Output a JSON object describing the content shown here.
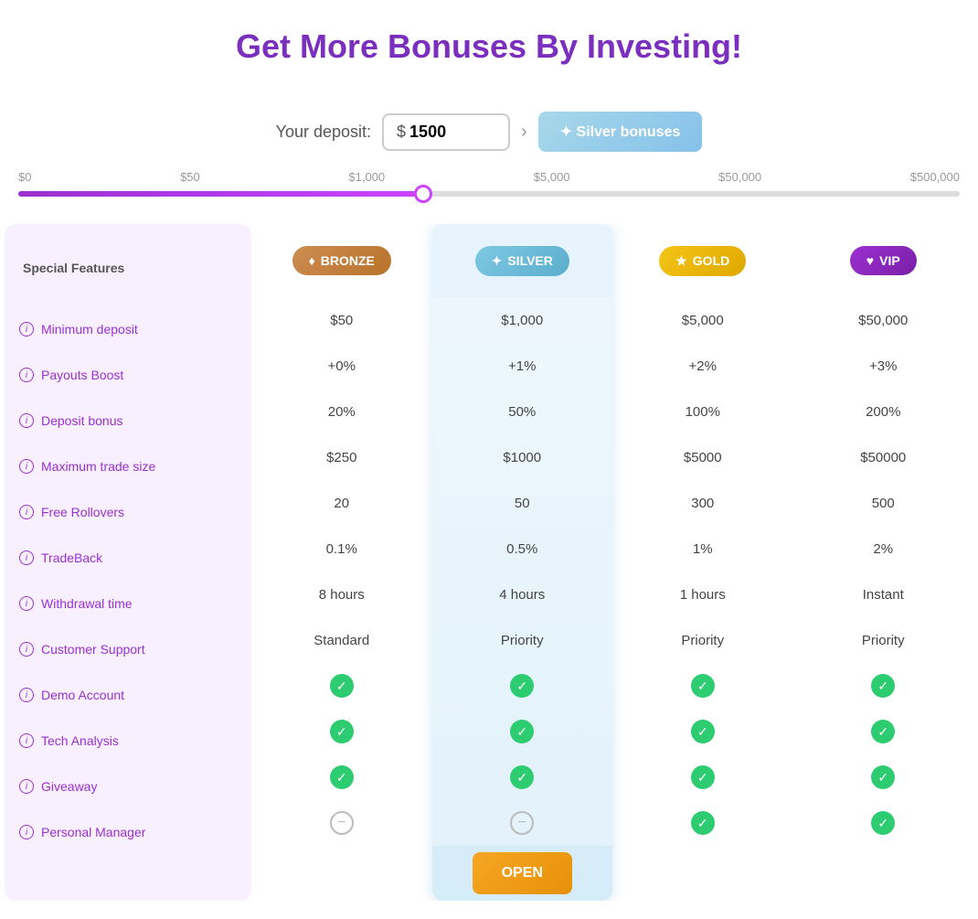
{
  "header": {
    "title": "Get More Bonuses By Investing!"
  },
  "deposit": {
    "label": "Your deposit:",
    "value": "1500",
    "dollar_sign": "$",
    "arrow": "›",
    "button_label": "✦ Silver bonuses"
  },
  "slider": {
    "labels": [
      "$0",
      "$50",
      "$1,000",
      "$5,000",
      "$50,000",
      "$500,000"
    ],
    "fill_percent": 43
  },
  "features": {
    "header": "Special Features",
    "rows": [
      {
        "label": "Minimum deposit"
      },
      {
        "label": "Payouts Boost"
      },
      {
        "label": "Deposit bonus"
      },
      {
        "label": "Maximum trade size"
      },
      {
        "label": "Free Rollovers"
      },
      {
        "label": "TradeBack"
      },
      {
        "label": "Withdrawal time"
      },
      {
        "label": "Customer Support"
      },
      {
        "label": "Demo Account"
      },
      {
        "label": "Tech Analysis"
      },
      {
        "label": "Giveaway"
      },
      {
        "label": "Personal Manager"
      }
    ]
  },
  "tiers": [
    {
      "id": "bronze",
      "badge_label": "BRONZE",
      "badge_symbol": "♦",
      "badge_class": "badge-bronze",
      "values": [
        "$50",
        "+0%",
        "20%",
        "$250",
        "20",
        "0.1%",
        "8 hours",
        "Standard"
      ],
      "demo_account": true,
      "tech_analysis": true,
      "giveaway": true,
      "personal_manager": false,
      "has_button": false
    },
    {
      "id": "silver",
      "badge_label": "SILVER",
      "badge_symbol": "✦",
      "badge_class": "badge-silver",
      "values": [
        "$1,000",
        "+1%",
        "50%",
        "$1000",
        "50",
        "0.5%",
        "4 hours",
        "Priority"
      ],
      "demo_account": true,
      "tech_analysis": true,
      "giveaway": true,
      "personal_manager": false,
      "has_button": true,
      "button_label": "OPEN"
    },
    {
      "id": "gold",
      "badge_label": "GOLD",
      "badge_symbol": "★",
      "badge_class": "badge-gold",
      "values": [
        "$5,000",
        "+2%",
        "100%",
        "$5000",
        "300",
        "1%",
        "1 hours",
        "Priority"
      ],
      "demo_account": true,
      "tech_analysis": true,
      "giveaway": true,
      "personal_manager": true,
      "has_button": false
    },
    {
      "id": "vip",
      "badge_label": "VIP",
      "badge_symbol": "♥",
      "badge_class": "badge-vip",
      "values": [
        "$50,000",
        "+3%",
        "200%",
        "$50000",
        "500",
        "2%",
        "Instant",
        "Priority"
      ],
      "demo_account": true,
      "tech_analysis": true,
      "giveaway": true,
      "personal_manager": true,
      "has_button": false
    }
  ],
  "icons": {
    "check": "✓",
    "minus": "−",
    "info": "i"
  }
}
